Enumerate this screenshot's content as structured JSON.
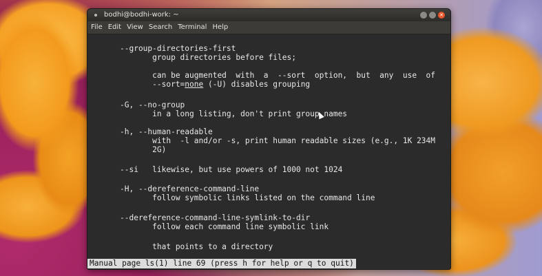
{
  "window": {
    "title": "bodhi@bodhi-work: ~"
  },
  "menubar": {
    "items": [
      "File",
      "Edit",
      "View",
      "Search",
      "Terminal",
      "Help"
    ]
  },
  "terminal": {
    "lines": {
      "l1": "--group-directories-first",
      "l2": "       group directories before files;",
      "l3a": "       can be augmented  with  a  --sort  option,  but  any  use  of",
      "l3b_pre": "       --sort=",
      "l3b_u": "none",
      "l3b_post": " (-U) disables grouping",
      "l4": "-G, --no-group",
      "l5": "       in a long listing, don't print group names",
      "l6": "-h, --human-readable",
      "l7a": "       with  -l and/or -s, print human readable sizes (e.g., 1K 234M",
      "l7b": "       2G)",
      "l8": "--si   likewise, but use powers of 1000 not 1024",
      "l9": "-H, --dereference-command-line",
      "l10": "       follow symbolic links listed on the command line",
      "l11": "--dereference-command-line-symlink-to-dir",
      "l12": "       follow each command line symbolic link",
      "l13": "       that points to a directory"
    },
    "status": "Manual page ls(1) line 69 (press h for help or q to quit)"
  },
  "colors": {
    "terminal_bg": "#2b2b2b",
    "terminal_fg": "#e8e8e8",
    "close_button": "#e8562b"
  }
}
